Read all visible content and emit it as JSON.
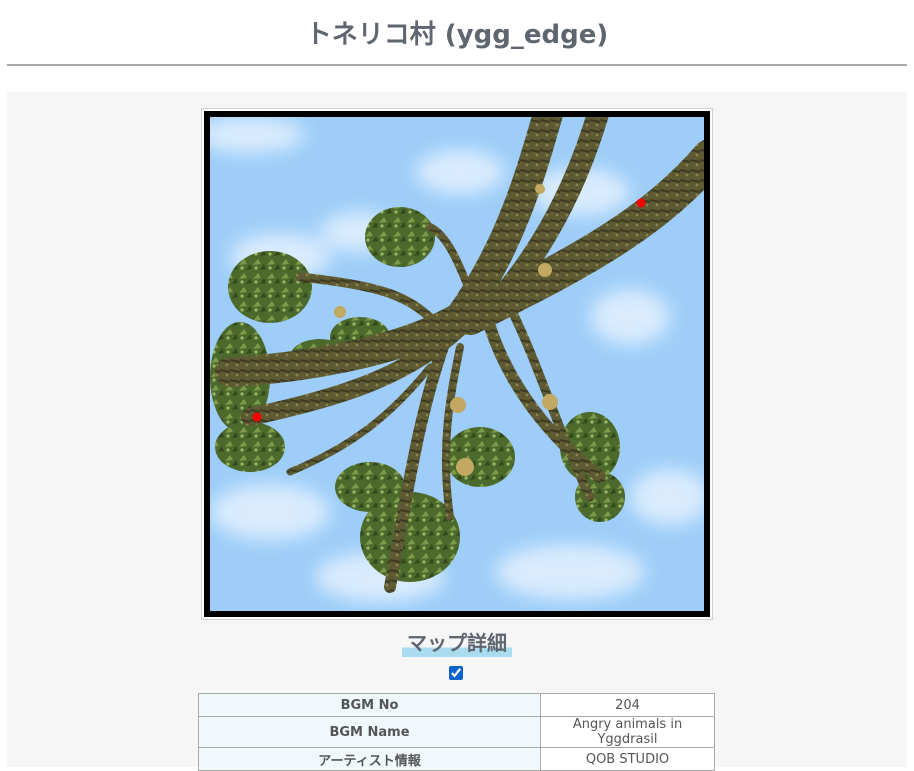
{
  "page": {
    "title": "トネリコ村 (ygg_edge)"
  },
  "map": {
    "warp_color": "#ff0000",
    "sky_color": "#9dcdf8"
  },
  "section": {
    "heading": "マップ詳細",
    "toggle_checked": true
  },
  "details": {
    "rows": [
      {
        "label": "BGM No",
        "value": "204"
      },
      {
        "label": "BGM Name",
        "value": "Angry animals in Yggdrasil"
      },
      {
        "label": "アーティスト情報",
        "value": "QOB STUDIO"
      }
    ]
  }
}
